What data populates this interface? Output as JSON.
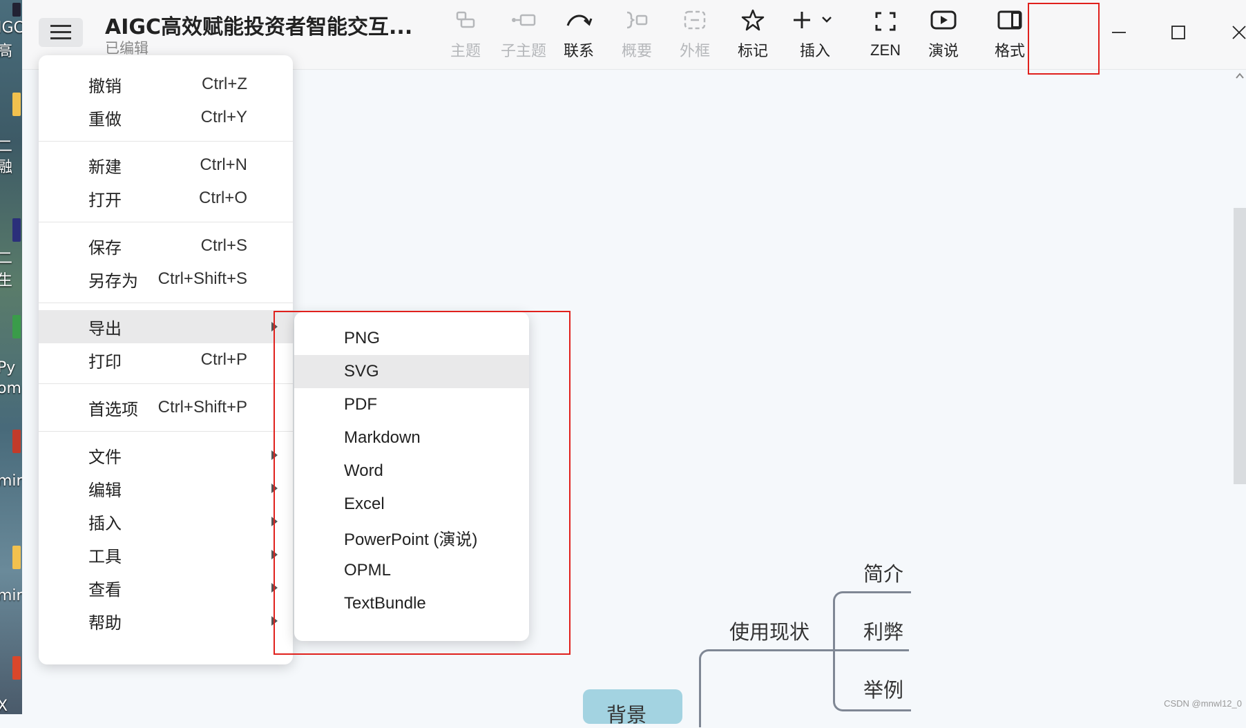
{
  "desktop": {
    "labels": [
      "IGC",
      "高",
      "二",
      "融",
      "二",
      "生",
      "Py",
      "om",
      "mir",
      "mir",
      "X"
    ]
  },
  "titlebar": {
    "doc_title": "AIGC高效赋能投资者智能交互...",
    "doc_status": "已编辑"
  },
  "toolbar": [
    {
      "label": "主题",
      "icon": "topic-icon",
      "enabled": false
    },
    {
      "label": "子主题",
      "icon": "subtopic-icon",
      "enabled": false
    },
    {
      "label": "联系",
      "icon": "relationship-icon",
      "enabled": true
    },
    {
      "label": "概要",
      "icon": "summary-icon",
      "enabled": false
    },
    {
      "label": "外框",
      "icon": "boundary-icon",
      "enabled": false
    },
    {
      "label": "标记",
      "icon": "star-icon",
      "enabled": true
    },
    {
      "label": "插入",
      "icon": "plus-icon",
      "enabled": true
    },
    {
      "label": "ZEN",
      "icon": "fullscreen-icon",
      "enabled": true
    },
    {
      "label": "演说",
      "icon": "play-icon",
      "enabled": true
    },
    {
      "label": "格式",
      "icon": "format-panel-icon",
      "enabled": true
    }
  ],
  "main_menu": {
    "items": [
      {
        "label": "撤销",
        "shortcut": "Ctrl+Z"
      },
      {
        "label": "重做",
        "shortcut": "Ctrl+Y"
      },
      {
        "label": "新建",
        "shortcut": "Ctrl+N"
      },
      {
        "label": "打开",
        "shortcut": "Ctrl+O"
      },
      {
        "label": "保存",
        "shortcut": "Ctrl+S"
      },
      {
        "label": "另存为",
        "shortcut": "Ctrl+Shift+S"
      },
      {
        "label": "导出",
        "shortcut": ""
      },
      {
        "label": "打印",
        "shortcut": "Ctrl+P"
      },
      {
        "label": "首选项",
        "shortcut": "Ctrl+Shift+P"
      },
      {
        "label": "文件",
        "shortcut": ""
      },
      {
        "label": "编辑",
        "shortcut": ""
      },
      {
        "label": "插入",
        "shortcut": ""
      },
      {
        "label": "工具",
        "shortcut": ""
      },
      {
        "label": "查看",
        "shortcut": ""
      },
      {
        "label": "帮助",
        "shortcut": ""
      }
    ],
    "highlighted": "导出"
  },
  "export_menu": {
    "items": [
      "PNG",
      "SVG",
      "PDF",
      "Markdown",
      "Word",
      "Excel",
      "PowerPoint (演说)",
      "OPML",
      "TextBundle"
    ],
    "highlighted": "SVG"
  },
  "mindmap": {
    "central": "背景",
    "branch": "使用现状",
    "children": [
      "简介",
      "利弊",
      "举例"
    ]
  },
  "watermark": "CSDN @mnwl12_0",
  "colors": {
    "annotation_red": "#e0201c",
    "highlight": "#e9e9ea",
    "central_node": "#a3d3e1"
  }
}
